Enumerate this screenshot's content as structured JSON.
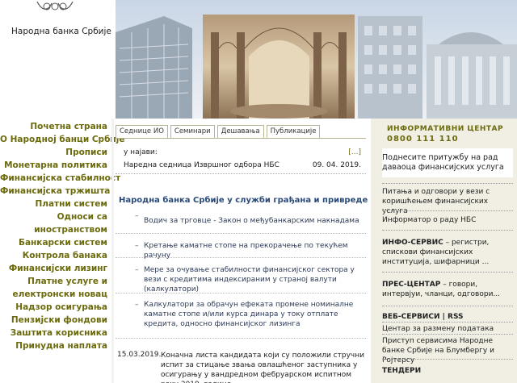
{
  "header": {
    "bank_name": "Народна банка Србије"
  },
  "leftnav": [
    "Почетна страна",
    "О Народној банци Србије",
    "Прописи",
    "Монетарна политика",
    "Финансијска стабилност",
    "Финансијска тржишта",
    "Платни систем",
    "Односи са",
    "иностранством",
    "Банкарски систем",
    "Контрола банака",
    "Финансијски лизинг",
    "Платне услуге и",
    "електронски новац",
    "Надзор осигурања",
    "Пензијски фондови",
    "Заштита корисника",
    "Принудна наплата"
  ],
  "tabs": [
    "Седнице ИО",
    "Семинари",
    "Дешавања",
    "Публикације"
  ],
  "news": {
    "heading": "у најави:",
    "more": "[...]",
    "row_text": "Наредна седница Извршног одбора НБС",
    "row_date": "09. 04. 2019."
  },
  "main": {
    "title": "Народна банка Србије у служби грађана и привреде",
    "links": [
      "Водич за трговце - Закон о међубанкарским накнадама",
      "Кретање каматне стопе на прекорачење по текућем рачуну",
      "Мере за очување стабилности финансијског сектора у вези с кредитима индексираним у страној валути (калкулатори)",
      "Калкулатори за обрачун ефеката промене номиналне каматне стопе и/или курса динара у току отплате кредита, односно финансијског лизинга"
    ],
    "item_date": "15.03.2019.",
    "item_text": "Коначна листа кандидата који су положили стручни испит за стицање звања овлашћеног заступника у осигурању у вандредном фебруарском испитном року 2019. године"
  },
  "right": {
    "info_title": "ИНФОРМАТИВНИ ЦЕНТАР",
    "info_phone": "0800 111 110",
    "complaint": "Поднесите притужбу на рад даваоца финансијских услуга",
    "qa": "Питања и одговори у вези с коришћењем финансијских услуга",
    "informator": "Информатор о раду НБС",
    "info_service_title": "ИНФО-СЕРВИС",
    "info_service_text": " – регистри, спискови финансијских институција, шифарници ...",
    "press_title": "ПРЕС-ЦЕНТАР",
    "press_text": " – говори, интервјуи, чланци, одговори...",
    "webservices": "ВЕБ-СЕРВИСИ | RSS",
    "data_exchange": "Центар за размену података",
    "bloomberg": "Приступ сервисима Народне банке Србије на Блумбергу и Ројтерсу",
    "tenders": "ТЕНДЕРИ"
  }
}
